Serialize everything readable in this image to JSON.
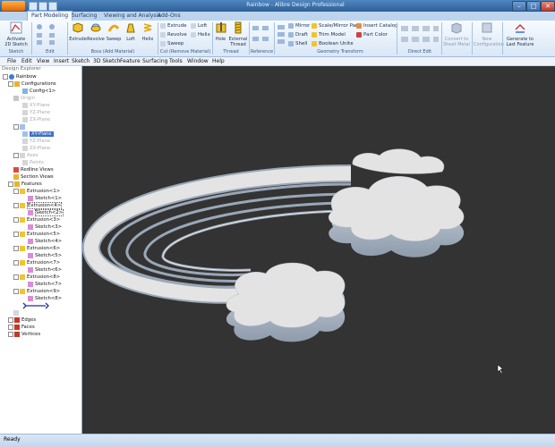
{
  "window": {
    "title": "Rainbow - Alibre Design Professional",
    "minimize": "–",
    "maximize": "□",
    "close": "✕"
  },
  "app_button": "",
  "tabs": [
    {
      "label": "Part Modeling"
    },
    {
      "label": "Surfacing"
    },
    {
      "label": "Viewing and Analysis"
    },
    {
      "label": "Add-Ons"
    }
  ],
  "ribbon": {
    "sketch_group": {
      "label": "Sketch",
      "activate_label": "Activate\n2D Sketch"
    },
    "edit_group": {
      "label": "Edit"
    },
    "boss_group": {
      "label": "Boss (Add Material)",
      "extrude": "Extrude",
      "revolve": "Revolve",
      "sweep": "Sweep",
      "loft": "Loft",
      "helix": "Helix"
    },
    "cut_group": {
      "label": "Cut (Remove Material)",
      "extrude": "Extrude",
      "revolve": "Revolve",
      "sweep": "Sweep",
      "loft": "Loft",
      "helix": "Helix"
    },
    "thread_group": {
      "label": "Thread",
      "hole": "Hole",
      "external_thread": "External\nThread"
    },
    "reference_group": {
      "label": "Reference"
    },
    "geometry_group": {
      "label": "Geometry Transform",
      "mirror": "Mirror",
      "draft": "Draft",
      "shell": "Shell",
      "scale_mirror": "Scale/Mirror Part",
      "trim_model": "Trim Model",
      "boolean_union": "Boolean Unite",
      "insert_catalog": "Insert Catalog",
      "part_color": "Part Color"
    },
    "direct_group": {
      "label": "Direct Edit"
    },
    "convert_sheet_metal": "Convert to\nSheet Metal",
    "new_configuration": "New\nConfiguration",
    "generate_feature": "Generate to\nLast Feature"
  },
  "menus": [
    "File",
    "Edit",
    "View",
    "Insert",
    "Sketch",
    "3D Sketch",
    "Feature",
    "Surfacing",
    "Tools",
    "Window",
    "Help"
  ],
  "tree": {
    "header": "Design Explorer",
    "root": "Rainbow",
    "configurations": "Configurations",
    "config1": "Config<1>",
    "planes_dim": [
      "Origin",
      "XY-Plane",
      "YZ-Plane",
      "ZX-Plane"
    ],
    "xy_plane": "XY-Plane",
    "planes2_dim": [
      "YZ-Plane",
      "ZX-Plane"
    ],
    "dim_items": [
      "Axes",
      "Points"
    ],
    "redline": "Redline Views",
    "section": "Section Views",
    "features": "Features",
    "feature_items": [
      {
        "name": "Extrusion<1>",
        "sketch": "Sketch<1>"
      },
      {
        "name": "Extrusion<4>",
        "sketch": "Sketch<2>"
      },
      {
        "name": "Extrusion<3>",
        "sketch": "Sketch<3>"
      },
      {
        "name": "Extrusion<5>",
        "sketch": "Sketch<4>"
      },
      {
        "name": "Extrusion<6>",
        "sketch": "Sketch<5>"
      },
      {
        "name": "Extrusion<7>",
        "sketch": "Sketch<6>"
      },
      {
        "name": "Extrusion<8>",
        "sketch": "Sketch<7>"
      },
      {
        "name": "Extrusion<9>",
        "sketch": "Sketch<8>"
      }
    ],
    "edges": "Edges",
    "faces": "Faces",
    "vertices": "Vertices"
  },
  "status": "Ready"
}
